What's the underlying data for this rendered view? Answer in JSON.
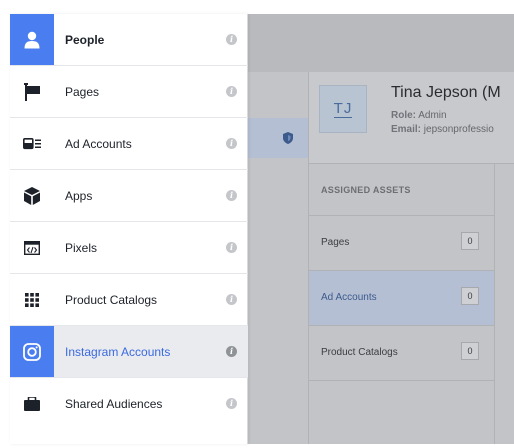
{
  "menu": {
    "items": [
      {
        "label": "People",
        "icon": "person-icon",
        "state": "active"
      },
      {
        "label": "Pages",
        "icon": "flag-icon",
        "state": "normal"
      },
      {
        "label": "Ad Accounts",
        "icon": "ad-account-icon",
        "state": "normal"
      },
      {
        "label": "Apps",
        "icon": "cube-icon",
        "state": "normal"
      },
      {
        "label": "Pixels",
        "icon": "code-icon",
        "state": "normal"
      },
      {
        "label": "Product Catalogs",
        "icon": "grid-icon",
        "state": "normal"
      },
      {
        "label": "Instagram Accounts",
        "icon": "instagram-icon",
        "state": "hover"
      },
      {
        "label": "Shared Audiences",
        "icon": "briefcase-icon",
        "state": "normal"
      }
    ],
    "info_glyph": "i"
  },
  "profile": {
    "initials": "TJ",
    "name": "Tina Jepson (M",
    "role_label": "Role:",
    "role_value": "Admin",
    "email_label": "Email:",
    "email_value": "jepsonprofessio"
  },
  "assets": {
    "header": "ASSIGNED ASSETS",
    "rows": [
      {
        "label": "Pages",
        "count": "0"
      },
      {
        "label": "Ad Accounts",
        "count": "0"
      },
      {
        "label": "Product Catalogs",
        "count": "0"
      }
    ]
  },
  "colors": {
    "accent": "#4a7ef0",
    "menu_text": "#1d2129",
    "hover_row": "#e9ebee",
    "selected_row": "#b4bfd3",
    "overlay_gray": "#c3c4c7"
  }
}
